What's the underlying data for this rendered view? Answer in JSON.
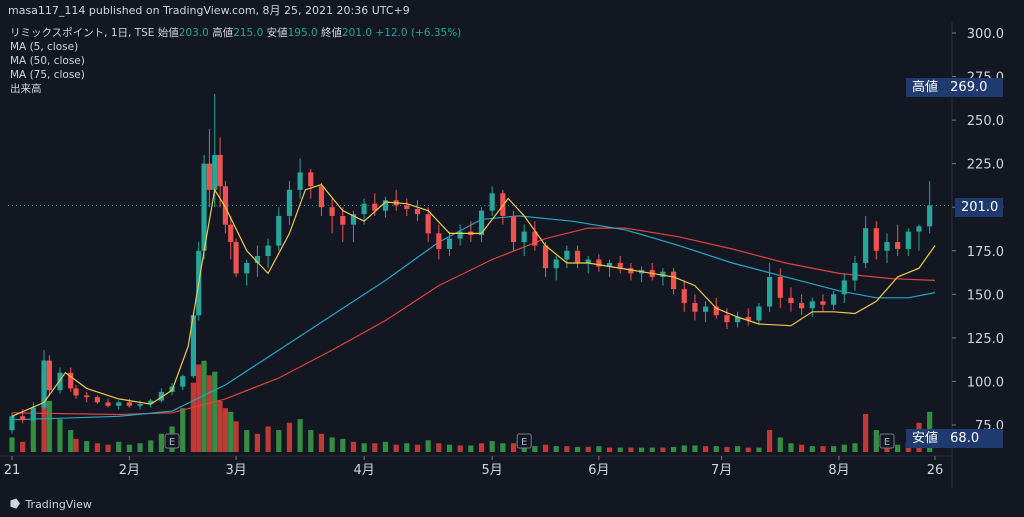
{
  "header": {
    "published": "masa117_114 published on TradingView.com, 8月 25, 2021 20:36 UTC+9"
  },
  "legend": {
    "symbol": "リミックスポイント, 1日, TSE",
    "open_label": "始値",
    "open": "203.0",
    "high_label": "高値",
    "high": "215.0",
    "low_label": "安値",
    "low": "195.0",
    "close_label": "終値",
    "close": "201.0",
    "change": "+12.0 (+6.35%)",
    "ma5": "MA (5, close)",
    "ma50": "MA (50, close)",
    "ma75": "MA (75, close)",
    "volume": "出来高"
  },
  "tags": {
    "high_label": "高値",
    "high_value": "269.0",
    "last_value": "201.0",
    "low_label": "安値",
    "low_value": "68.0"
  },
  "earnings_marker": "E",
  "brand": "TradingView",
  "colors": {
    "up": "#26a69a",
    "down": "#ef5350",
    "ma5": "#f2c94c",
    "ma50": "#26a6c5",
    "ma75": "#e04141",
    "vol_up": "#3aa34a",
    "vol_down": "#e0403a",
    "tag_bg": "#1e3a6e"
  },
  "chart_data": {
    "type": "candlestick",
    "y_ticks": [
      "300.0",
      "275.0",
      "250.0",
      "225.0",
      "200.0",
      "175.0",
      "150.0",
      "125.0",
      "100.0",
      "75.0"
    ],
    "ylim": [
      68,
      300
    ],
    "x_ticks": [
      {
        "label": "21",
        "day": 0
      },
      {
        "label": "2月",
        "day": 22
      },
      {
        "label": "3月",
        "day": 42
      },
      {
        "label": "4月",
        "day": 66
      },
      {
        "label": "5月",
        "day": 90
      },
      {
        "label": "6月",
        "day": 110
      },
      {
        "label": "7月",
        "day": 133
      },
      {
        "label": "8月",
        "day": 155
      },
      {
        "label": "26",
        "day": 173
      }
    ],
    "earnings_days": [
      30,
      96,
      164
    ],
    "ma5_points": [
      [
        0,
        80
      ],
      [
        6,
        88
      ],
      [
        10,
        105
      ],
      [
        14,
        96
      ],
      [
        20,
        90
      ],
      [
        26,
        87
      ],
      [
        30,
        95
      ],
      [
        33,
        120
      ],
      [
        36,
        175
      ],
      [
        38,
        210
      ],
      [
        40,
        200
      ],
      [
        44,
        175
      ],
      [
        48,
        162
      ],
      [
        52,
        185
      ],
      [
        55,
        210
      ],
      [
        58,
        213
      ],
      [
        62,
        198
      ],
      [
        66,
        192
      ],
      [
        70,
        203
      ],
      [
        74,
        202
      ],
      [
        78,
        198
      ],
      [
        82,
        185
      ],
      [
        88,
        185
      ],
      [
        93,
        205
      ],
      [
        96,
        195
      ],
      [
        100,
        178
      ],
      [
        104,
        168
      ],
      [
        108,
        168
      ],
      [
        112,
        166
      ],
      [
        118,
        163
      ],
      [
        124,
        160
      ],
      [
        128,
        155
      ],
      [
        132,
        142
      ],
      [
        136,
        137
      ],
      [
        140,
        133
      ],
      [
        146,
        132
      ],
      [
        150,
        140
      ],
      [
        154,
        140
      ],
      [
        158,
        139
      ],
      [
        162,
        146
      ],
      [
        166,
        160
      ],
      [
        170,
        165
      ],
      [
        173,
        178
      ]
    ],
    "ma50_points": [
      [
        0,
        78
      ],
      [
        20,
        80
      ],
      [
        30,
        83
      ],
      [
        40,
        98
      ],
      [
        50,
        118
      ],
      [
        60,
        138
      ],
      [
        70,
        158
      ],
      [
        80,
        180
      ],
      [
        88,
        193
      ],
      [
        95,
        195
      ],
      [
        105,
        192
      ],
      [
        115,
        187
      ],
      [
        125,
        178
      ],
      [
        135,
        168
      ],
      [
        145,
        160
      ],
      [
        155,
        152
      ],
      [
        162,
        148
      ],
      [
        168,
        148
      ],
      [
        173,
        151
      ]
    ],
    "ma75_points": [
      [
        0,
        82
      ],
      [
        20,
        81
      ],
      [
        30,
        82
      ],
      [
        40,
        90
      ],
      [
        50,
        102
      ],
      [
        60,
        118
      ],
      [
        70,
        135
      ],
      [
        80,
        155
      ],
      [
        90,
        170
      ],
      [
        100,
        182
      ],
      [
        108,
        188
      ],
      [
        115,
        188
      ],
      [
        125,
        183
      ],
      [
        135,
        176
      ],
      [
        145,
        168
      ],
      [
        155,
        162
      ],
      [
        165,
        159
      ],
      [
        173,
        158
      ]
    ],
    "candles": [
      [
        0,
        72,
        82,
        70,
        80
      ],
      [
        2,
        80,
        84,
        76,
        78
      ],
      [
        4,
        78,
        88,
        77,
        85
      ],
      [
        6,
        85,
        118,
        84,
        112
      ],
      [
        7,
        112,
        115,
        92,
        95
      ],
      [
        9,
        95,
        108,
        93,
        105
      ],
      [
        11,
        105,
        108,
        94,
        96
      ],
      [
        12,
        96,
        98,
        90,
        92
      ],
      [
        14,
        92,
        94,
        88,
        91
      ],
      [
        16,
        91,
        92,
        87,
        88
      ],
      [
        18,
        88,
        90,
        85,
        86
      ],
      [
        20,
        86,
        89,
        84,
        88
      ],
      [
        22,
        88,
        90,
        85,
        86
      ],
      [
        24,
        86,
        89,
        84,
        87
      ],
      [
        26,
        87,
        90,
        85,
        89
      ],
      [
        28,
        89,
        96,
        88,
        94
      ],
      [
        30,
        94,
        99,
        92,
        97
      ],
      [
        32,
        97,
        104,
        95,
        103
      ],
      [
        34,
        103,
        140,
        102,
        138
      ],
      [
        35,
        138,
        180,
        135,
        175
      ],
      [
        36,
        175,
        230,
        170,
        225
      ],
      [
        37,
        225,
        245,
        200,
        210
      ],
      [
        38,
        210,
        265,
        200,
        230
      ],
      [
        39,
        230,
        240,
        200,
        212
      ],
      [
        40,
        212,
        215,
        185,
        190
      ],
      [
        41,
        190,
        195,
        170,
        180
      ],
      [
        42,
        180,
        182,
        160,
        162
      ],
      [
        44,
        162,
        170,
        155,
        168
      ],
      [
        46,
        168,
        178,
        160,
        172
      ],
      [
        48,
        172,
        182,
        165,
        178
      ],
      [
        50,
        178,
        200,
        175,
        195
      ],
      [
        52,
        195,
        215,
        190,
        210
      ],
      [
        54,
        210,
        228,
        205,
        220
      ],
      [
        56,
        220,
        222,
        205,
        212
      ],
      [
        58,
        212,
        214,
        195,
        200
      ],
      [
        60,
        200,
        205,
        185,
        195
      ],
      [
        62,
        195,
        200,
        180,
        190
      ],
      [
        64,
        190,
        198,
        180,
        196
      ],
      [
        66,
        196,
        205,
        190,
        202
      ],
      [
        68,
        202,
        208,
        195,
        198
      ],
      [
        70,
        198,
        206,
        194,
        204
      ],
      [
        72,
        204,
        210,
        198,
        201
      ],
      [
        74,
        201,
        205,
        195,
        199
      ],
      [
        76,
        199,
        204,
        192,
        196
      ],
      [
        78,
        196,
        200,
        180,
        185
      ],
      [
        80,
        185,
        190,
        170,
        176
      ],
      [
        82,
        176,
        186,
        172,
        182
      ],
      [
        84,
        182,
        190,
        178,
        186
      ],
      [
        86,
        186,
        192,
        180,
        184
      ],
      [
        88,
        184,
        200,
        180,
        198
      ],
      [
        90,
        198,
        212,
        195,
        208
      ],
      [
        92,
        208,
        210,
        190,
        195
      ],
      [
        94,
        195,
        198,
        175,
        180
      ],
      [
        96,
        180,
        190,
        172,
        186
      ],
      [
        98,
        186,
        192,
        175,
        178
      ],
      [
        100,
        178,
        180,
        160,
        165
      ],
      [
        102,
        165,
        172,
        158,
        170
      ],
      [
        104,
        170,
        178,
        165,
        175
      ],
      [
        106,
        175,
        178,
        165,
        168
      ],
      [
        108,
        168,
        172,
        162,
        170
      ],
      [
        110,
        170,
        173,
        163,
        166
      ],
      [
        112,
        166,
        170,
        160,
        168
      ],
      [
        114,
        168,
        172,
        162,
        165
      ],
      [
        116,
        165,
        168,
        158,
        162
      ],
      [
        118,
        162,
        166,
        157,
        164
      ],
      [
        120,
        164,
        168,
        158,
        160
      ],
      [
        122,
        160,
        165,
        155,
        163
      ],
      [
        124,
        163,
        165,
        150,
        153
      ],
      [
        126,
        153,
        158,
        140,
        145
      ],
      [
        128,
        145,
        150,
        135,
        140
      ],
      [
        130,
        140,
        146,
        134,
        143
      ],
      [
        132,
        143,
        148,
        136,
        138
      ],
      [
        134,
        138,
        142,
        130,
        134
      ],
      [
        136,
        134,
        140,
        131,
        137
      ],
      [
        138,
        137,
        142,
        132,
        135
      ],
      [
        140,
        135,
        145,
        133,
        143
      ],
      [
        142,
        143,
        168,
        140,
        160
      ],
      [
        144,
        160,
        165,
        142,
        148
      ],
      [
        146,
        148,
        154,
        140,
        145
      ],
      [
        148,
        145,
        150,
        138,
        142
      ],
      [
        150,
        142,
        148,
        137,
        146
      ],
      [
        152,
        146,
        150,
        140,
        144
      ],
      [
        154,
        144,
        152,
        141,
        150
      ],
      [
        156,
        150,
        162,
        145,
        158
      ],
      [
        158,
        158,
        172,
        152,
        168
      ],
      [
        160,
        168,
        195,
        165,
        188
      ],
      [
        162,
        188,
        192,
        170,
        175
      ],
      [
        164,
        175,
        185,
        168,
        180
      ],
      [
        166,
        180,
        190,
        172,
        176
      ],
      [
        168,
        176,
        188,
        172,
        186
      ],
      [
        170,
        186,
        190,
        175,
        189
      ],
      [
        172,
        189,
        215,
        185,
        201
      ]
    ],
    "volume": [
      [
        0,
        20,
        1
      ],
      [
        2,
        14,
        0
      ],
      [
        4,
        60,
        1
      ],
      [
        6,
        110,
        0
      ],
      [
        7,
        70,
        1
      ],
      [
        9,
        45,
        1
      ],
      [
        11,
        30,
        1
      ],
      [
        12,
        18,
        0
      ],
      [
        14,
        15,
        1
      ],
      [
        16,
        12,
        0
      ],
      [
        18,
        10,
        0
      ],
      [
        20,
        14,
        1
      ],
      [
        22,
        10,
        1
      ],
      [
        24,
        12,
        1
      ],
      [
        26,
        16,
        1
      ],
      [
        28,
        25,
        1
      ],
      [
        30,
        35,
        1
      ],
      [
        32,
        60,
        1
      ],
      [
        34,
        95,
        0
      ],
      [
        35,
        120,
        0
      ],
      [
        36,
        125,
        1
      ],
      [
        37,
        105,
        0
      ],
      [
        38,
        110,
        1
      ],
      [
        39,
        70,
        0
      ],
      [
        40,
        60,
        0
      ],
      [
        41,
        55,
        1
      ],
      [
        42,
        42,
        0
      ],
      [
        44,
        30,
        1
      ],
      [
        46,
        25,
        0
      ],
      [
        48,
        35,
        0
      ],
      [
        50,
        30,
        1
      ],
      [
        52,
        40,
        0
      ],
      [
        54,
        45,
        1
      ],
      [
        56,
        30,
        1
      ],
      [
        58,
        25,
        0
      ],
      [
        60,
        20,
        1
      ],
      [
        62,
        18,
        1
      ],
      [
        64,
        14,
        0
      ],
      [
        66,
        12,
        1
      ],
      [
        68,
        12,
        0
      ],
      [
        70,
        14,
        1
      ],
      [
        72,
        10,
        0
      ],
      [
        74,
        12,
        1
      ],
      [
        76,
        10,
        0
      ],
      [
        78,
        16,
        1
      ],
      [
        80,
        12,
        0
      ],
      [
        82,
        10,
        1
      ],
      [
        84,
        9,
        0
      ],
      [
        86,
        9,
        1
      ],
      [
        88,
        12,
        0
      ],
      [
        90,
        15,
        1
      ],
      [
        92,
        12,
        1
      ],
      [
        94,
        12,
        0
      ],
      [
        96,
        9,
        1
      ],
      [
        98,
        8,
        1
      ],
      [
        100,
        10,
        0
      ],
      [
        102,
        8,
        1
      ],
      [
        104,
        8,
        0
      ],
      [
        106,
        7,
        1
      ],
      [
        108,
        7,
        0
      ],
      [
        110,
        8,
        1
      ],
      [
        112,
        6,
        0
      ],
      [
        114,
        6,
        1
      ],
      [
        116,
        6,
        0
      ],
      [
        118,
        6,
        1
      ],
      [
        120,
        6,
        1
      ],
      [
        122,
        6,
        0
      ],
      [
        124,
        7,
        1
      ],
      [
        126,
        9,
        1
      ],
      [
        128,
        9,
        1
      ],
      [
        130,
        8,
        0
      ],
      [
        132,
        8,
        1
      ],
      [
        134,
        7,
        0
      ],
      [
        136,
        8,
        1
      ],
      [
        138,
        6,
        0
      ],
      [
        140,
        6,
        1
      ],
      [
        142,
        30,
        0
      ],
      [
        144,
        20,
        1
      ],
      [
        146,
        12,
        1
      ],
      [
        148,
        10,
        0
      ],
      [
        150,
        8,
        1
      ],
      [
        152,
        8,
        0
      ],
      [
        154,
        8,
        1
      ],
      [
        156,
        10,
        1
      ],
      [
        158,
        12,
        1
      ],
      [
        160,
        52,
        0
      ],
      [
        162,
        30,
        1
      ],
      [
        164,
        12,
        0
      ],
      [
        166,
        10,
        1
      ],
      [
        168,
        14,
        0
      ],
      [
        170,
        40,
        0
      ],
      [
        172,
        55,
        1
      ]
    ]
  }
}
